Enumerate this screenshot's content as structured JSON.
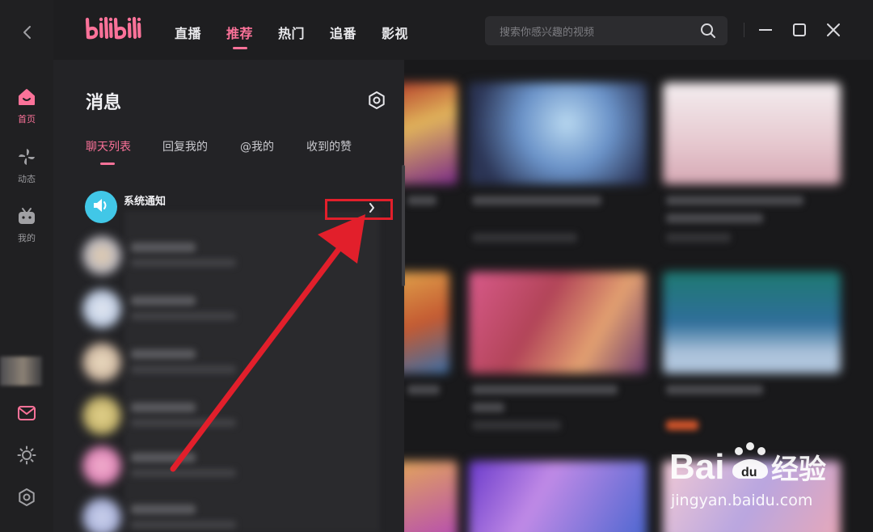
{
  "header": {
    "logo_text": "bilibili",
    "tabs": [
      {
        "label": "直播",
        "active": false
      },
      {
        "label": "推荐",
        "active": true
      },
      {
        "label": "热门",
        "active": false
      },
      {
        "label": "追番",
        "active": false
      },
      {
        "label": "影视",
        "active": false
      }
    ],
    "search_placeholder": "搜索你感兴趣的视频",
    "accent_color": "#fb7299"
  },
  "sidebar": {
    "items": [
      {
        "label": "首页",
        "icon": "home-icon",
        "active": true
      },
      {
        "label": "动态",
        "icon": "pinwheel-icon",
        "active": false
      },
      {
        "label": "我的",
        "icon": "tv-icon",
        "active": false
      }
    ],
    "bottom_icons": [
      "mail-icon",
      "sun-icon",
      "settings-icon"
    ]
  },
  "messages": {
    "title": "消息",
    "tabs": [
      {
        "label": "聊天列表",
        "active": true
      },
      {
        "label": "回复我的",
        "active": false
      },
      {
        "label": "@我的",
        "active": false
      },
      {
        "label": "收到的赞",
        "active": false
      }
    ],
    "system_notice": {
      "name": "系统通知",
      "icon": "speaker-icon",
      "icon_color": "#41c7e7"
    }
  },
  "annotation": {
    "box_color": "#e21f2b",
    "arrow_color": "#e21f2b"
  },
  "watermark": {
    "brand": "Bai du经验",
    "url": "jingyan.baidu.com"
  }
}
